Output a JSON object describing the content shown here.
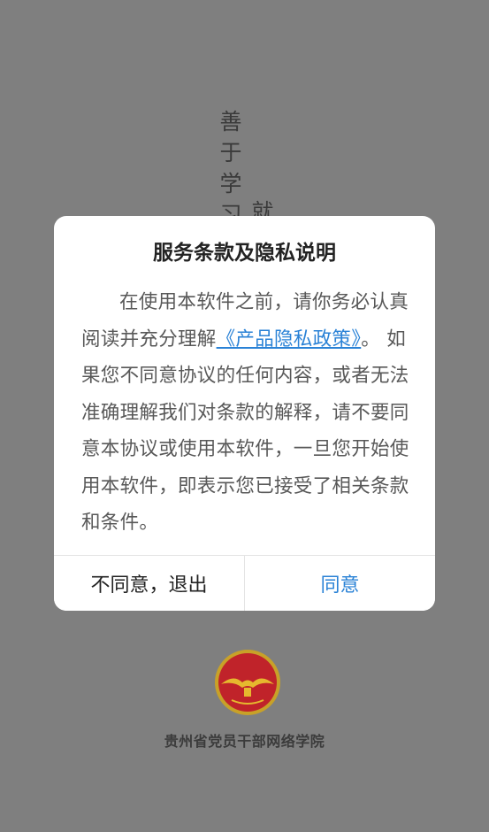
{
  "splash": {
    "slogan_col1": "善\n于\n学\n习",
    "slogan_col2": "就",
    "org_name": "贵州省党员干部网络学院",
    "logo_colors": {
      "ring": "#c8a128",
      "disc": "#c0232a",
      "emblem": "#e6b82e"
    }
  },
  "dialog": {
    "title": "服务条款及隐私说明",
    "body_before_link": "在使用本软件之前，请你务必认真阅读并充分理解",
    "link_text": "《产品隐私政策》",
    "body_after_link": "。 如果您不同意协议的任何内容，或者无法准确理解我们对条款的解释，请不要同意本协议或使用本软件，一旦您开始使用本软件，即表示您已接受了相关条款和条件。",
    "disagree_label": "不同意，退出",
    "agree_label": "同意",
    "accent_color": "#2a82d6"
  }
}
